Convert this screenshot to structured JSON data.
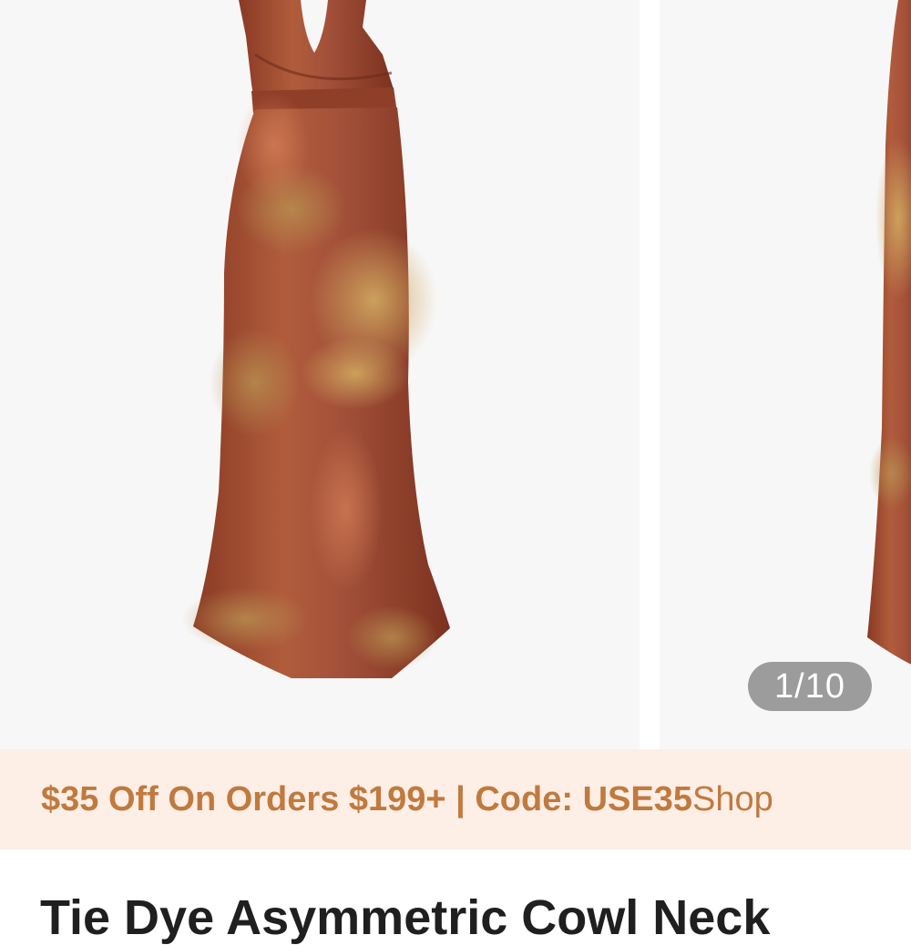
{
  "gallery": {
    "counter": "1/10",
    "current_image": 1,
    "total_images": 10
  },
  "promo": {
    "bold_text": "$35 Off On Orders $199+ | Code: USE35",
    "trailing_text": "Shop"
  },
  "product": {
    "title": "Tie Dye Asymmetric Cowl Neck"
  },
  "colors": {
    "promo_background": "#fdeee6",
    "promo_text": "#c07a3e",
    "dress_base": "#9a4a2e",
    "dress_highlight": "#c9a25a"
  },
  "icons": {
    "main_image": "dress-product-image",
    "next_image": "dress-product-image-peek"
  }
}
